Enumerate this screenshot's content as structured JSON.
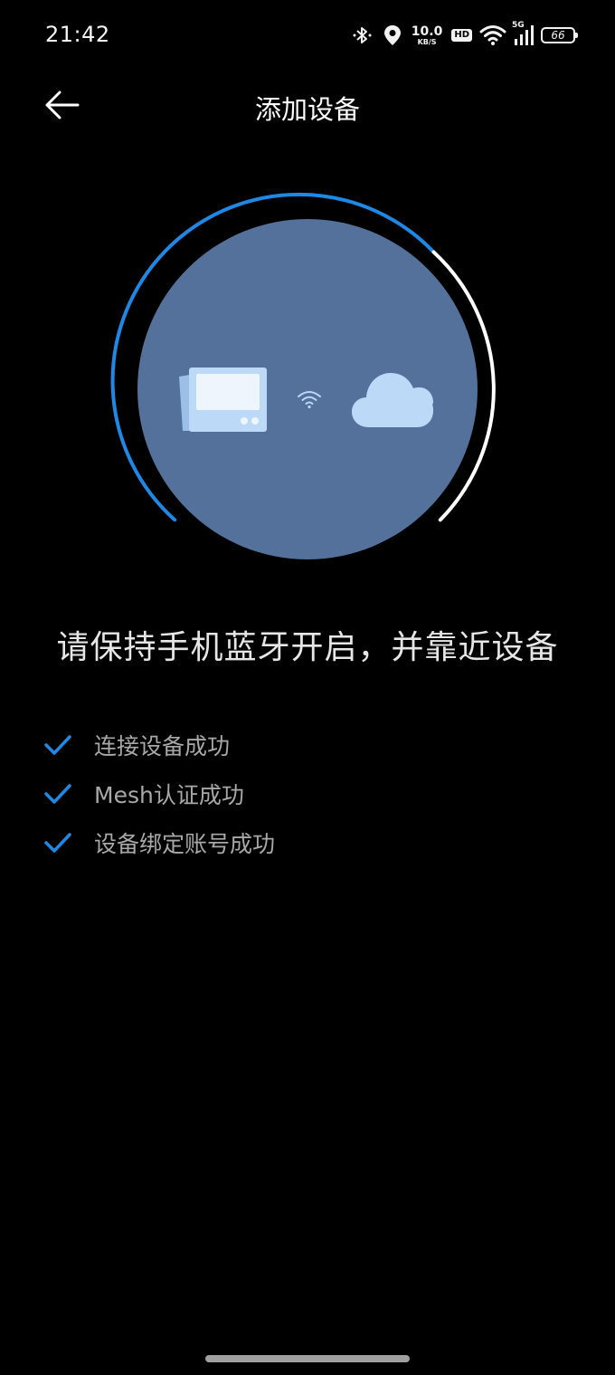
{
  "status_bar": {
    "time": "21:42",
    "net_speed_value": "10.0",
    "net_speed_unit": "KB/S",
    "hd_label": "HD",
    "signal_label": "5G",
    "battery": "66",
    "icons": [
      "bluetooth-icon",
      "location-icon",
      "wifi-icon",
      "signal-icon",
      "battery-icon"
    ]
  },
  "header": {
    "title": "添加设备",
    "back_icon": "arrow-left-icon"
  },
  "illustration": {
    "icons": [
      "device-icon",
      "wifi-small-icon",
      "cloud-icon"
    ],
    "colors": {
      "circle_fill": "#53719a",
      "ring_progress": "#1e88e5",
      "ring_rest": "#ffffff",
      "icon_light": "#bcd9f8"
    }
  },
  "instruction": "请保持手机蓝牙开启，并靠近设备",
  "steps": [
    {
      "label": "连接设备成功",
      "status": "done"
    },
    {
      "label": "Mesh认证成功",
      "status": "done"
    },
    {
      "label": "设备绑定账号成功",
      "status": "done"
    }
  ],
  "colors": {
    "background": "#000000",
    "accent": "#1e88e5",
    "step_text": "#a8a8a8"
  }
}
